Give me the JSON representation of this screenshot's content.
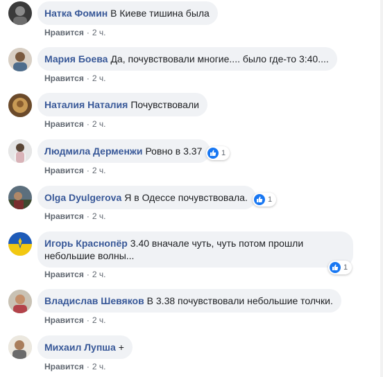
{
  "comments": [
    {
      "author": "Натка Фомин",
      "text": "В Киеве тишина была",
      "like": "Нравится",
      "sep": "·",
      "time": "2 ч."
    },
    {
      "author": "Мария Боева",
      "text": "Да, почувствовали многие.... было где-то 3:40....",
      "like": "Нравится",
      "sep": "·",
      "time": "2 ч."
    },
    {
      "author": "Наталия Наталия",
      "text": "Почувствовали",
      "like": "Нравится",
      "sep": "·",
      "time": "2 ч."
    },
    {
      "author": "Людмила Дерменжи",
      "text": "Ровно в 3.37",
      "like": "Нравится",
      "sep": "·",
      "time": "2 ч.",
      "reactions": "1"
    },
    {
      "author": "Olga Dyulgerova",
      "text": "Я в Одессе почувствовала.",
      "like": "Нравится",
      "sep": "·",
      "time": "2 ч.",
      "reactions": "1"
    },
    {
      "author": "Игорь Краснопёр",
      "text": "3.40 вначале чуть, чуть потом прошли небольшие волны...",
      "like": "Нравится",
      "sep": "·",
      "time": "2 ч.",
      "reactions": "1"
    },
    {
      "author": "Владислав Шевяков",
      "text": "В 3.38 почувствовали небольшие толчки.",
      "like": "Нравится",
      "sep": "·",
      "time": "2 ч."
    },
    {
      "author": "Михаил Лупша",
      "text": "+",
      "like": "Нравится",
      "sep": "·",
      "time": "2 ч."
    }
  ],
  "colors": {
    "author": "#385898",
    "bubble": "#f0f2f5",
    "like_badge": "#1877f2",
    "meta": "#606770"
  }
}
